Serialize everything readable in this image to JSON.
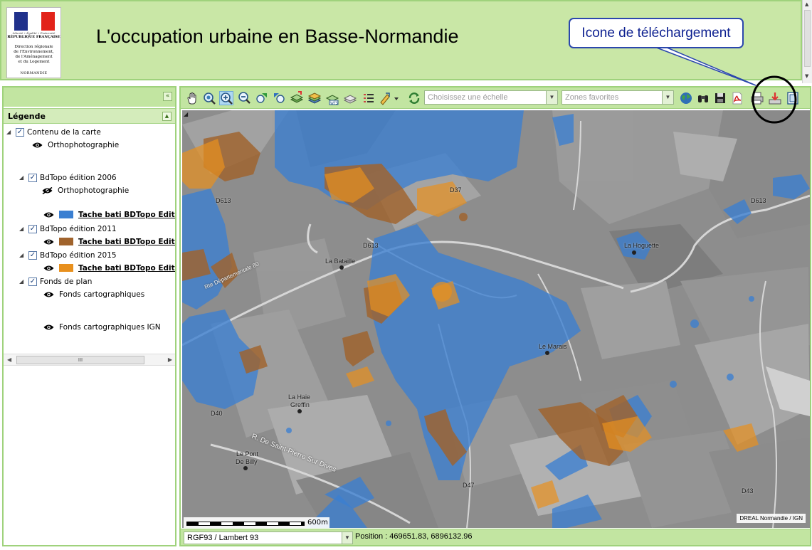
{
  "header": {
    "title": "L'occupation urbaine en Basse-Normandie",
    "logo": {
      "motto": "Liberté • Égalité • Fraternité",
      "republic": "RÉPUBLIQUE FRANÇAISE",
      "direction": "Direction régionale\nde l'Environnement,\nde l'Aménagement\net du Logement",
      "region": "NORMANDIE"
    }
  },
  "callout": {
    "text": "Icone de téléchargement"
  },
  "legend": {
    "title": "Légende",
    "tree": [
      {
        "label": "Contenu de la carte",
        "checked": true
      },
      {
        "label": "Orthophotographie"
      },
      {
        "label": "BdTopo édition 2006",
        "checked": true
      },
      {
        "label": "Orthophotographie",
        "hidden": true
      },
      {
        "label": "Tache bati BDTopo Edition",
        "color": "#3b7fd1"
      },
      {
        "label": "BdTopo édition 2011",
        "checked": true
      },
      {
        "label": "Tache bati BDTopo Edition",
        "color": "#a0632c"
      },
      {
        "label": "BdTopo édition 2015",
        "checked": true
      },
      {
        "label": "Tache bati BDTopo Edition",
        "color": "#e8901e"
      },
      {
        "label": "Fonds de plan",
        "checked": true
      },
      {
        "label": "Fonds cartographiques"
      },
      {
        "label": "Fonds cartographiques IGN"
      }
    ],
    "scroll_thumb": "III"
  },
  "toolbar": {
    "scale_placeholder": "Choisissez une échelle",
    "favorites_placeholder": "Zones favorites",
    "icons": [
      "pan-icon",
      "zoom-extent-icon",
      "zoom-in-icon",
      "zoom-out-icon",
      "previous-view-icon",
      "next-view-icon",
      "add-layer-icon",
      "layers-icon",
      "wfs-icon",
      "measure-icon",
      "list-icon",
      "draw-icon",
      "refresh-icon",
      "globe-icon",
      "binoculars-icon",
      "save-icon",
      "pdf-icon",
      "print-icon",
      "download-icon",
      "export-icon"
    ]
  },
  "map": {
    "labels": {
      "d613_top": "D613",
      "d37": "D37",
      "d613_mid": "D613",
      "d613_right": "D613",
      "la_bataille": "La Bataille",
      "la_hoguette": "La Hoguette",
      "le_marais": "Le Marais",
      "la_haie": "La Haie",
      "greffin": "Greffin",
      "le_pont": "Le Pont",
      "de_billy": "De Billy",
      "d47": "D47",
      "d43": "D43",
      "d40": "D40",
      "rte_dep": "Rte Départementale 80",
      "r_st_pierre": "R. De Saint-Pierre Sur Dives"
    },
    "scale_text": "600m",
    "attribution": "DREAL Normandie / IGN"
  },
  "status": {
    "projection": "RGF93 / Lambert 93",
    "position_label": "Position : 469651.83, 6896132.96"
  },
  "colors": {
    "header_bg": "#c9e7a6",
    "panel_border": "#9fd27c",
    "layer_2006": "#3b7fd1",
    "layer_2011": "#a0632c",
    "layer_2015": "#e8901e",
    "callout_border": "#2b47ad"
  }
}
